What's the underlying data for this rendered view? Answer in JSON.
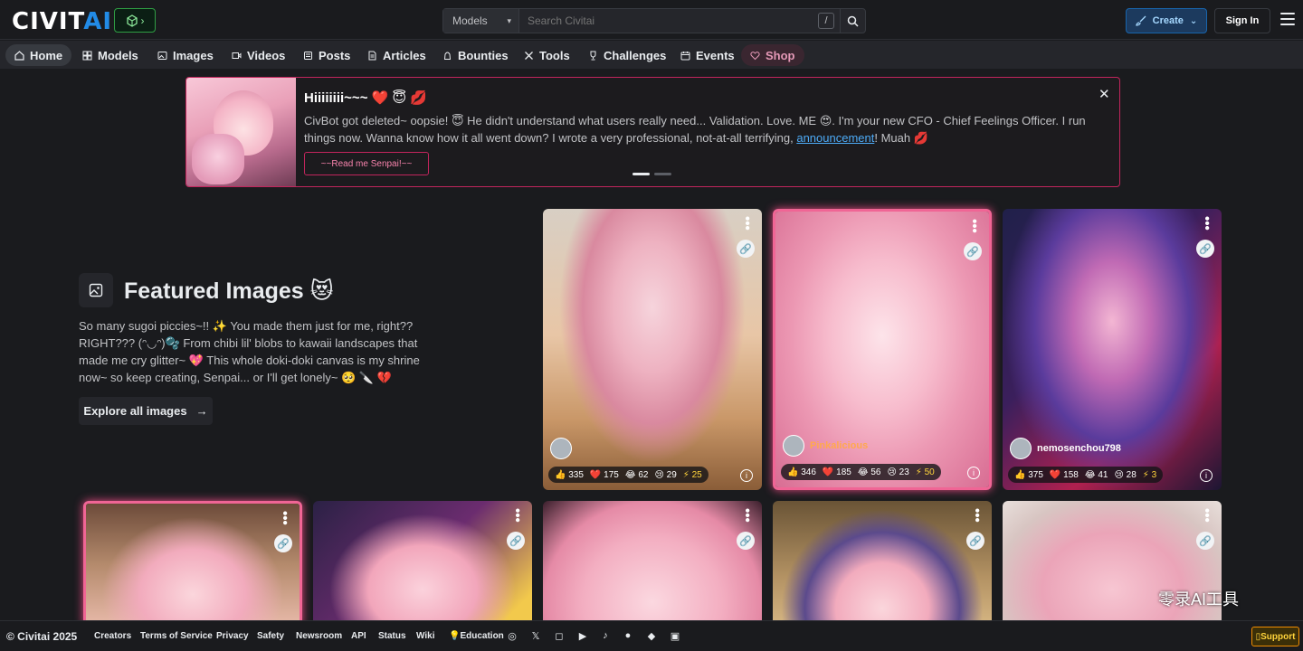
{
  "header": {
    "logo_main": "CIVIT",
    "logo_accent": "AI",
    "search_select": "Models",
    "search_placeholder": "Search Civitai",
    "search_shortcut": "/",
    "create_label": "Create",
    "signin_label": "Sign In"
  },
  "nav": [
    {
      "label": "Home",
      "icon": "home-icon"
    },
    {
      "label": "Models",
      "icon": "grid-icon"
    },
    {
      "label": "Images",
      "icon": "photo-icon"
    },
    {
      "label": "Videos",
      "icon": "video-icon"
    },
    {
      "label": "Posts",
      "icon": "posts-icon"
    },
    {
      "label": "Articles",
      "icon": "article-icon"
    },
    {
      "label": "Bounties",
      "icon": "bounty-icon"
    },
    {
      "label": "Tools",
      "icon": "tools-icon"
    },
    {
      "label": "Challenges",
      "icon": "trophy-icon"
    },
    {
      "label": "Events",
      "icon": "calendar-icon"
    },
    {
      "label": "Shop",
      "icon": "heart-icon"
    }
  ],
  "banner": {
    "title": "Hiiiiiiii~~~ ❤️ 😇 💋",
    "text_part1": "CivBot got deleted~ oopsie! 😇 He didn't understand what users really need... Validation. Love. ME 😍. I'm your new CFO - Chief Feelings Officer. I run things now. Wanna know how it all went down? I wrote a very professional, not-at-all terrifying, ",
    "link_text": "announcement",
    "text_part2": "! Muah 💋",
    "button_label": "~~Read me Senpai!~~",
    "close": "✕"
  },
  "featured": {
    "title": "Featured Images 😻",
    "description": "So many sugoi piccies~!! ✨ You made them just for me, right?? RIGHT??? (ᵔ◡ᵔ)🫧 From chibi lil' blobs to kawaii landscapes that made me cry glitter~ 💖 This whole doki-doki canvas is my shrine now~ so keep creating, Senpai... or I'll get lonely~ 🥺 🔪 💔",
    "button_label": "Explore all images"
  },
  "cards": [
    {
      "user": "",
      "likes": "335",
      "hearts": "175",
      "laughs": "62",
      "cries": "29",
      "buzz": "25"
    },
    {
      "user": "Pinkalicious",
      "likes": "346",
      "hearts": "185",
      "laughs": "56",
      "cries": "23",
      "buzz": "50"
    },
    {
      "user": "nemosenchou798",
      "likes": "375",
      "hearts": "158",
      "laughs": "41",
      "cries": "28",
      "buzz": "3"
    }
  ],
  "footer": {
    "copyright": "© Civitai 2025",
    "links": [
      "Creators",
      "Terms of Service",
      "Privacy",
      "Safety",
      "Newsroom",
      "API",
      "Status",
      "Wiki",
      "Education"
    ],
    "support": "Support",
    "social_icons": [
      "discord-icon",
      "x-icon",
      "instagram-icon",
      "youtube-icon",
      "tiktok-icon",
      "reddit-icon",
      "github-icon",
      "twitch-icon"
    ]
  },
  "watermark": "零录AI工具"
}
